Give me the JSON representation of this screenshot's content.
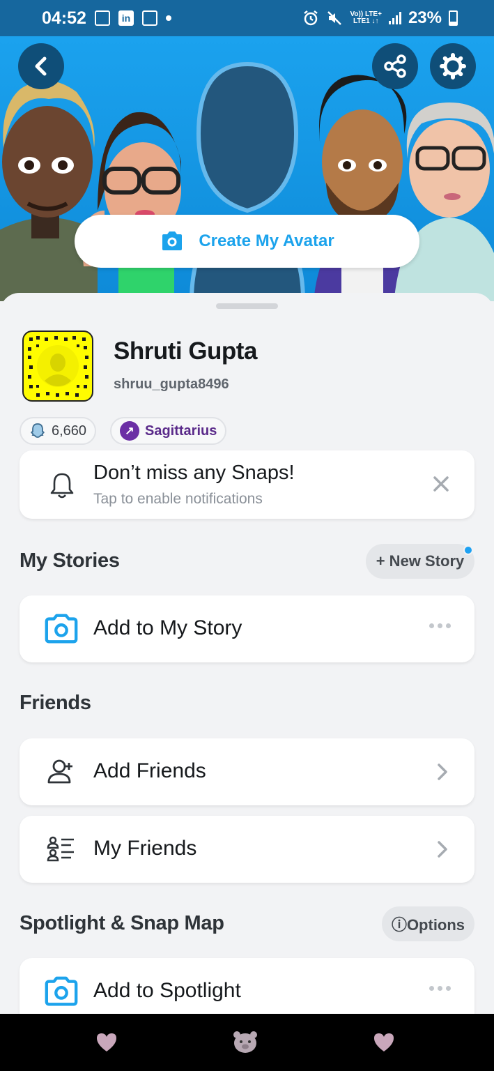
{
  "status_bar": {
    "time": "04:52",
    "net_top": "Vo)) LTE+",
    "net_bottom": "LTE1 ↓↑",
    "battery": "23%"
  },
  "hero": {
    "create_avatar_label": "Create My Avatar"
  },
  "profile": {
    "name": "Shruti Gupta",
    "username": "shruu_gupta8496",
    "snap_score": "6,660",
    "zodiac": "Sagittarius"
  },
  "notification_card": {
    "title": "Don’t miss any Snaps!",
    "subtitle": "Tap to enable notifications"
  },
  "my_stories": {
    "heading": "My Stories",
    "new_story_label": "+ New Story",
    "add_story_label": "Add to My Story"
  },
  "friends": {
    "heading": "Friends",
    "add_friends_label": "Add Friends",
    "my_friends_label": "My Friends"
  },
  "spotlight": {
    "heading": "Spotlight & Snap Map",
    "options_label": "ⓘOptions",
    "add_spotlight_label": "Add to Spotlight"
  },
  "colors": {
    "accent": "#1ca3ec",
    "snapcode": "#fffc00",
    "hero_bg": "#1ba2ee"
  }
}
